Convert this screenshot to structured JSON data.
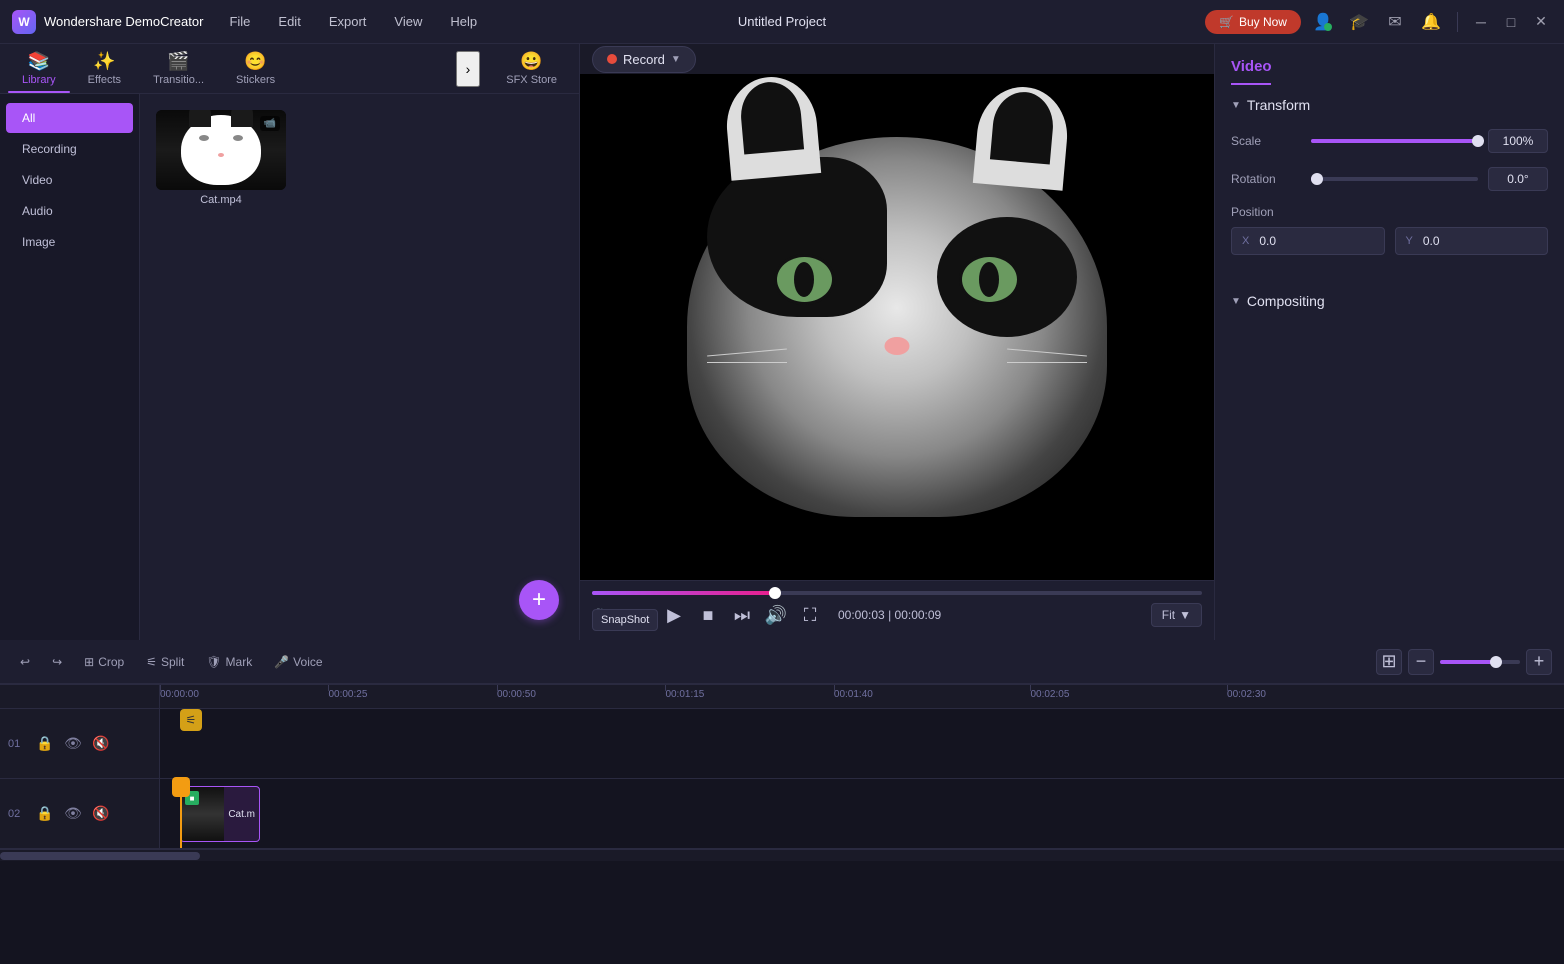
{
  "app": {
    "name": "Wondershare DemoCreator",
    "title": "Untitled Project"
  },
  "titlebar": {
    "menu_items": [
      "File",
      "Edit",
      "Export",
      "View",
      "Help"
    ],
    "buy_now": "Buy Now",
    "window_controls": [
      "─",
      "□",
      "✕"
    ]
  },
  "library_tabs": {
    "tabs": [
      {
        "label": "Library",
        "icon": "📚",
        "active": true
      },
      {
        "label": "Effects",
        "icon": "✨",
        "active": false
      },
      {
        "label": "Transitio...",
        "icon": "🎬",
        "active": false
      },
      {
        "label": "Stickers",
        "icon": "😊",
        "active": false
      },
      {
        "label": "SFX Store",
        "icon": "😀",
        "active": false
      }
    ]
  },
  "library_sidebar": {
    "items": [
      {
        "label": "All",
        "active": true
      },
      {
        "label": "Recording",
        "active": false
      },
      {
        "label": "Video",
        "active": false
      },
      {
        "label": "Audio",
        "active": false
      },
      {
        "label": "Image",
        "active": false
      }
    ]
  },
  "media_files": [
    {
      "name": "Cat.mp4",
      "type": "video"
    }
  ],
  "preview": {
    "record_btn": "Record",
    "time_current": "00:00:03",
    "time_total": "00:00:09",
    "fit_label": "Fit",
    "snapshot_tooltip": "SnapShot"
  },
  "toolbar": {
    "undo_label": "",
    "redo_label": "",
    "crop_label": "Crop",
    "split_label": "Split",
    "mark_label": "Mark",
    "voice_label": "Voice"
  },
  "right_panel": {
    "title": "Video",
    "transform": {
      "section": "Transform",
      "scale_label": "Scale",
      "scale_value": "100%",
      "rotation_label": "Rotation",
      "rotation_value": "0.0°",
      "position_label": "Position",
      "pos_x_label": "X",
      "pos_x_value": "0.0",
      "pos_y_label": "Y",
      "pos_y_value": "0.0"
    },
    "compositing": {
      "section": "Compositing"
    }
  },
  "timeline": {
    "tracks": [
      {
        "num": "01",
        "icons": [
          "lock",
          "eye",
          "audio"
        ]
      },
      {
        "num": "02",
        "icons": [
          "lock",
          "eye",
          "audio"
        ]
      }
    ],
    "ruler_marks": [
      "00:00:00",
      "00:00:25",
      "00:00:50",
      "00:01:15",
      "00:01:40",
      "00:02:05",
      "00:02:30"
    ],
    "clip": {
      "name": "Cat.m"
    }
  }
}
